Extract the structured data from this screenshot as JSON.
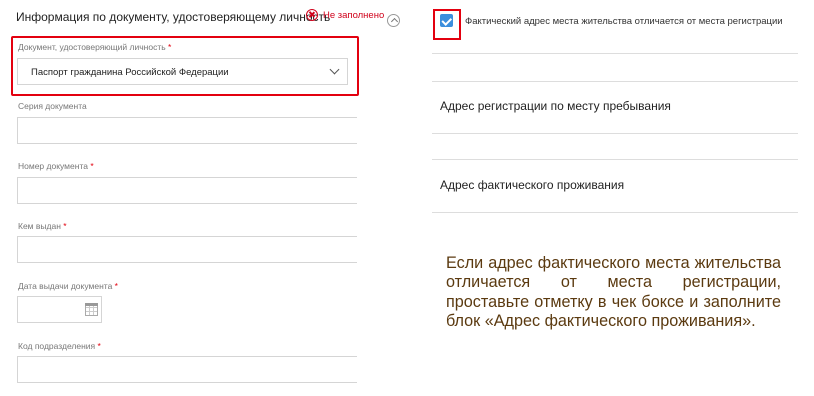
{
  "document_section": {
    "title": "Информация по документу, удостоверяющему личность",
    "status_text": "Не заполнено"
  },
  "fields": {
    "doc_type": {
      "label": "Документ, удостоверяющий личность",
      "required_mark": "*",
      "value": "Паспорт гражданина Российской Федерации"
    },
    "series": {
      "label": "Серия документа"
    },
    "number": {
      "label": "Номер документа",
      "required_mark": "*"
    },
    "issued_by": {
      "label": "Кем выдан",
      "required_mark": "*"
    },
    "issue_date": {
      "label": "Дата выдачи документа",
      "required_mark": "*"
    },
    "division_code": {
      "label": "Код подразделения",
      "required_mark": "*"
    }
  },
  "address": {
    "checkbox_label": "Фактический адрес места жительства отличается от места регистрации",
    "checkbox_checked": true,
    "registration_title": "Адрес регистрации по месту пребывания",
    "actual_title": "Адрес фактического проживания"
  },
  "annotation": "Если адрес фактического места жительства отличается от места регистрации, проставьте отметку в чек боксе и заполните блок «Адрес фактического проживания».",
  "colors": {
    "highlight": "#e3000f",
    "checkbox": "#3b8edd",
    "annotation_text": "#5b3a10"
  }
}
